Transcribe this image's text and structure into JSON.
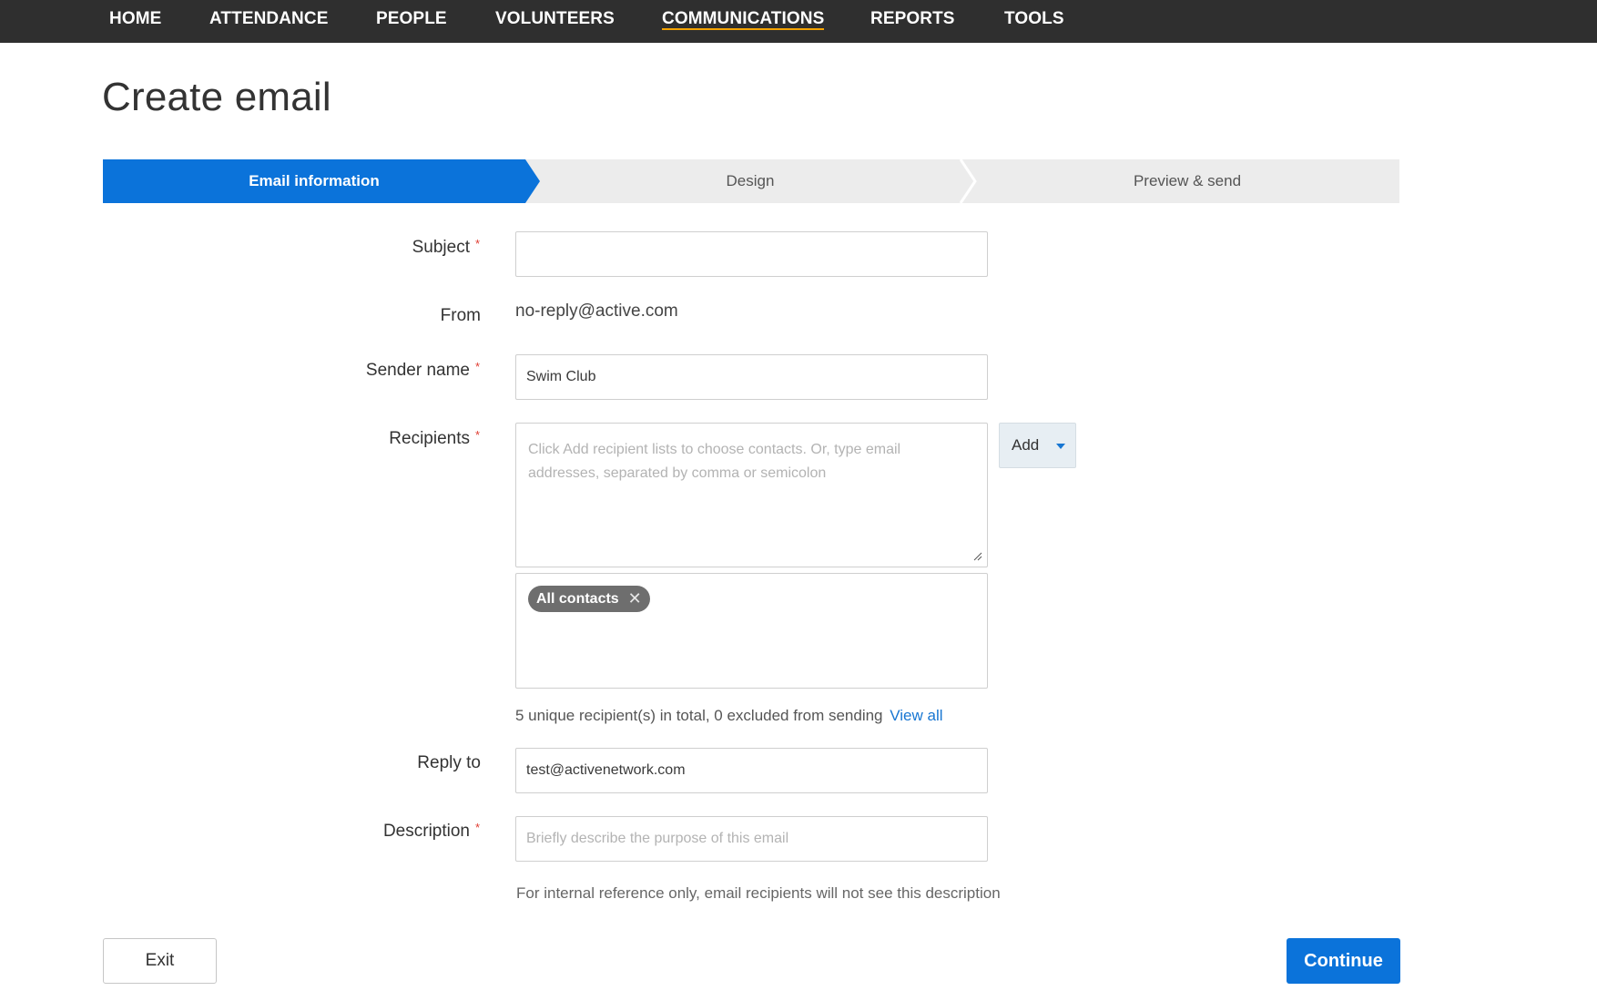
{
  "nav": {
    "items": [
      {
        "label": "HOME"
      },
      {
        "label": "ATTENDANCE"
      },
      {
        "label": "PEOPLE"
      },
      {
        "label": "VOLUNTEERS"
      },
      {
        "label": "COMMUNICATIONS",
        "active": true
      },
      {
        "label": "REPORTS"
      },
      {
        "label": "TOOLS"
      }
    ]
  },
  "page": {
    "title": "Create email"
  },
  "stepper": {
    "steps": [
      {
        "label": "Email information",
        "active": true
      },
      {
        "label": "Design",
        "active": false
      },
      {
        "label": "Preview & send",
        "active": false
      }
    ]
  },
  "form": {
    "subject": {
      "label": "Subject",
      "required": true,
      "value": ""
    },
    "from": {
      "label": "From",
      "value": "no-reply@active.com"
    },
    "sender_name": {
      "label": "Sender name",
      "required": true,
      "value": "Swim Club"
    },
    "recipients": {
      "label": "Recipients",
      "required": true,
      "placeholder": "Click Add recipient lists to choose contacts. Or, type email addresses, separated by comma or semicolon",
      "add_button": "Add",
      "chips": [
        {
          "label": "All contacts"
        }
      ],
      "summary": "5 unique recipient(s) in total, 0 excluded from sending",
      "view_all": "View all"
    },
    "reply_to": {
      "label": "Reply to",
      "value": "test@activenetwork.com"
    },
    "description": {
      "label": "Description",
      "required": true,
      "placeholder": "Briefly describe the purpose of this email",
      "helper": "For internal reference only, email recipients will not see this description"
    }
  },
  "actions": {
    "exit_label": "Exit",
    "continue_label": "Continue"
  },
  "icons": {
    "required_marker": "asterisk-icon",
    "add_caret": "chevron-down-icon",
    "chip_remove": "close-icon",
    "textarea_resize": "resize-grip-icon"
  },
  "colors": {
    "nav_bg": "#2f2f2f",
    "nav_active_underline": "#f5a300",
    "stepper_active": "#0b73da",
    "stepper_inactive": "#ececec",
    "primary_button": "#0b73da",
    "link": "#1776d2",
    "required": "#e03c31",
    "chip_bg": "#6e6e6e"
  }
}
